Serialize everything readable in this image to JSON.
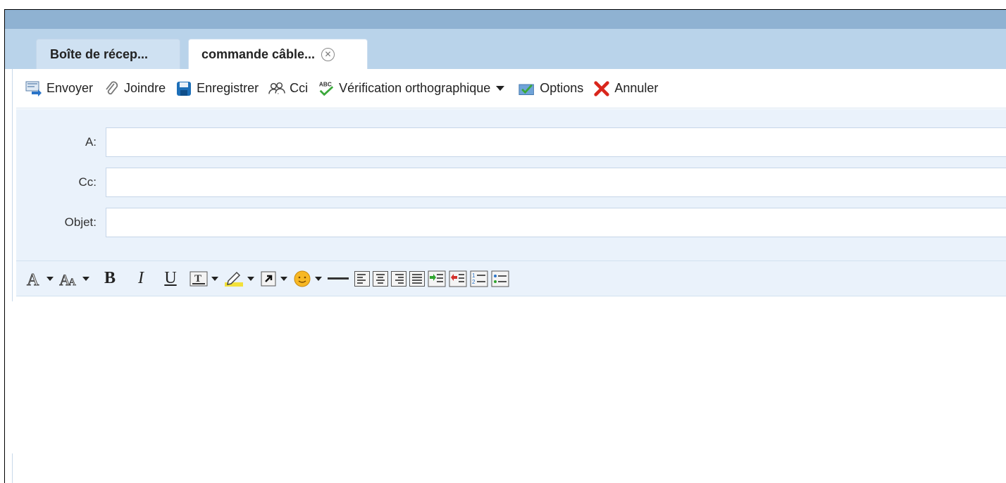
{
  "tabs": [
    {
      "label": "Boîte de récep...",
      "active": false
    },
    {
      "label": "commande câble...",
      "active": true,
      "close_icon": "close-circle-icon"
    }
  ],
  "toolbar": {
    "send": {
      "label": "Envoyer",
      "icon": "send-icon"
    },
    "attach": {
      "label": "Joindre",
      "icon": "paperclip-icon"
    },
    "save": {
      "label": "Enregistrer",
      "icon": "floppy-disk-icon"
    },
    "bcc": {
      "label": "Cci",
      "icon": "contacts-icon"
    },
    "spellcheck": {
      "label": "Vérification orthographique",
      "icon": "spellcheck-icon"
    },
    "options": {
      "label": "Options",
      "icon": "checklist-icon"
    },
    "cancel": {
      "label": "Annuler",
      "icon": "red-x-icon"
    }
  },
  "fields": {
    "to": {
      "label": "A:",
      "value": ""
    },
    "cc": {
      "label": "Cc:",
      "value": ""
    },
    "subject": {
      "label": "Objet:",
      "value": ""
    }
  },
  "formatting": {
    "bold": "B",
    "italic": "I",
    "underline": "U"
  },
  "colors": {
    "titlebar": "#8fb2d2",
    "tabstrip": "#b9d3ea",
    "form_bg": "#eaf2fb",
    "cancel_red": "#d9261c",
    "save_blue": "#1d6fb8"
  }
}
